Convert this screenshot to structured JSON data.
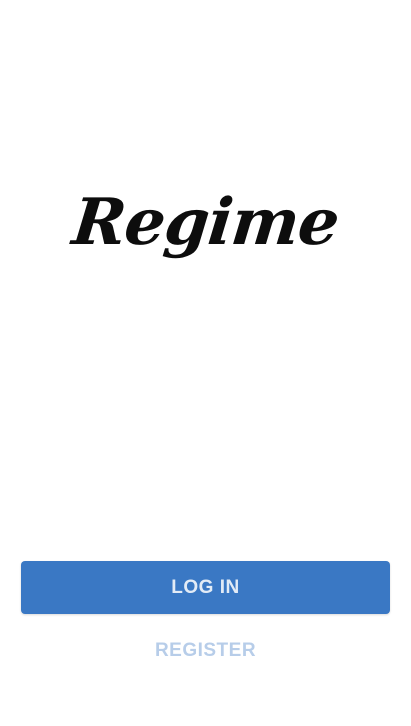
{
  "app": {
    "logo_text": "Regime"
  },
  "actions": {
    "login_label": "LOG IN",
    "register_label": "REGISTER"
  },
  "colors": {
    "primary": "#3a78c4",
    "primary_text": "#e2ebf6",
    "link_text": "#b7cde9",
    "background": "#ffffff",
    "logo": "#0d0d0d"
  }
}
